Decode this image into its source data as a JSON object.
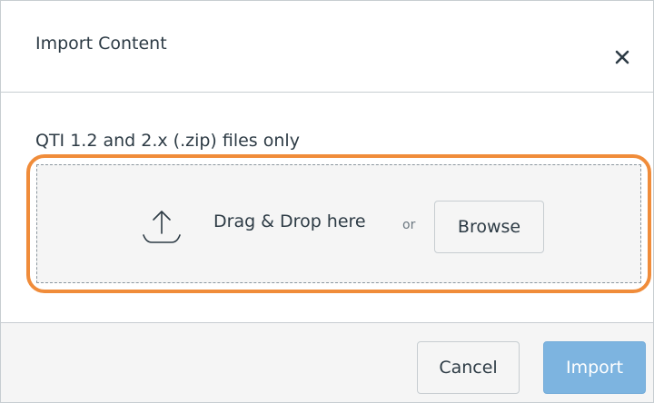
{
  "dialog": {
    "title": "Import Content",
    "close_icon": "close-icon"
  },
  "body": {
    "description": "QTI 1.2 and 2.x (.zip) files only",
    "dropzone": {
      "upload_icon": "upload-icon",
      "drop_label": "Drag & Drop here",
      "or_label": "or",
      "browse_label": "Browse"
    }
  },
  "footer": {
    "cancel_label": "Cancel",
    "import_label": "Import"
  },
  "colors": {
    "highlight": "#f08c3a",
    "primary_disabled": "#7db4e0",
    "text": "#2d3b45"
  }
}
